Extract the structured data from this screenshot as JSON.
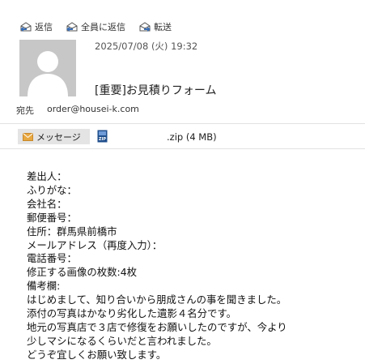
{
  "toolbar": {
    "reply": "返信",
    "reply_all": "全員に返信",
    "forward": "転送"
  },
  "header": {
    "date": "2025/07/08 (火) 19:32",
    "subject": "[重要]お見積りフォーム",
    "to_label": "宛先",
    "to_value": "order@housei-k.com"
  },
  "attachments": {
    "message_tab": "メッセージ",
    "zip_icon_text": "ZIP",
    "zip_name": ".zip (4 MB)"
  },
  "body": {
    "lines": [
      "差出人：",
      "ふりがな：",
      "会社名：",
      "郵便番号：",
      "住所：群馬県前橋市",
      "メールアドレス（再度入力）：",
      "電話番号：",
      "修正する画像の枚数:4枚",
      "備考欄:",
      "はじめまして、知り合いから朋成さんの事を聞きました。",
      "添付の写真はかなり劣化した遺影４名分です。",
      "地元の写真店で３店で修復をお願いしたのですが、今より",
      "少しマシになるくらいだと言われました。",
      "どうぞ宜しくお願い致します。"
    ]
  },
  "colors": {
    "avatar_bg": "#c7c7c7",
    "tab_bg": "#e4e4e4",
    "envelope": "#e8a840",
    "zip_icon": "#1f4e8c"
  }
}
